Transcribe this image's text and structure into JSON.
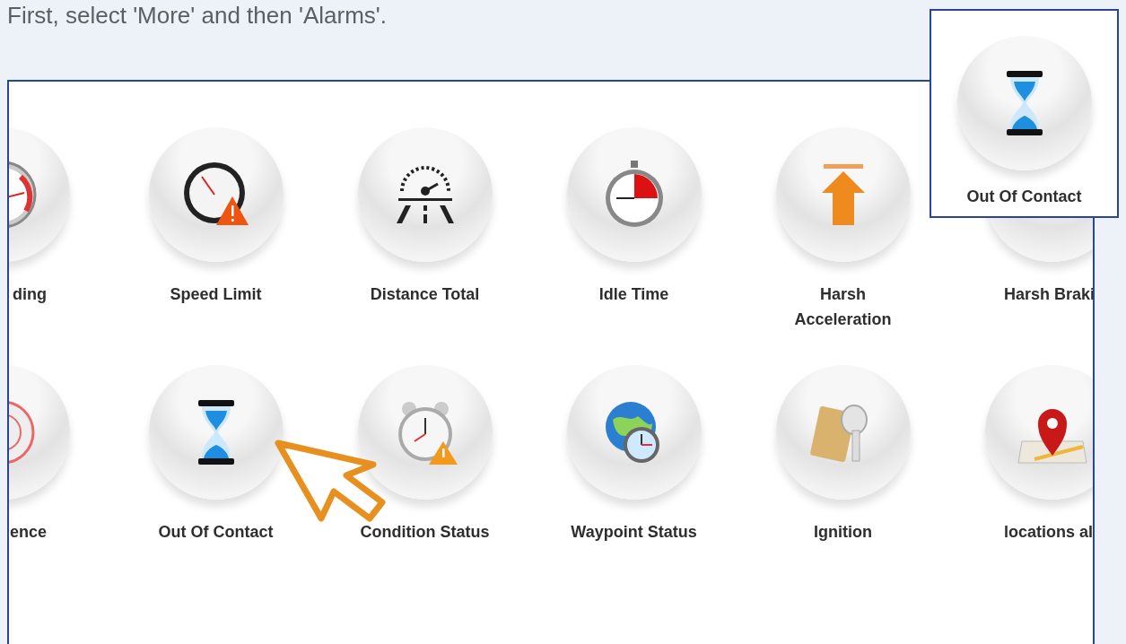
{
  "instruction": "First, select 'More' and then 'Alarms'.",
  "alarms": [
    {
      "label": "ding",
      "kind": "gauge"
    },
    {
      "label": "Speed Limit",
      "kind": "speedometer-warning"
    },
    {
      "label": "Distance Total",
      "kind": "road-gauge"
    },
    {
      "label": "Idle Time",
      "kind": "stopwatch"
    },
    {
      "label": "Harsh Acceleration",
      "kind": "arrow-up"
    },
    {
      "label": "Harsh Braki"
    },
    {
      "label": "ence",
      "kind": "target"
    },
    {
      "label": "Out Of Contact",
      "kind": "hourglass"
    },
    {
      "label": "Condition Status",
      "kind": "alarm-clock"
    },
    {
      "label": "Waypoint Status",
      "kind": "globe-clock"
    },
    {
      "label": "Ignition",
      "kind": "key"
    },
    {
      "label": "locations al",
      "kind": "map-pin"
    }
  ],
  "zoom_callout": {
    "label": "Out Of Contact",
    "kind": "hourglass"
  }
}
